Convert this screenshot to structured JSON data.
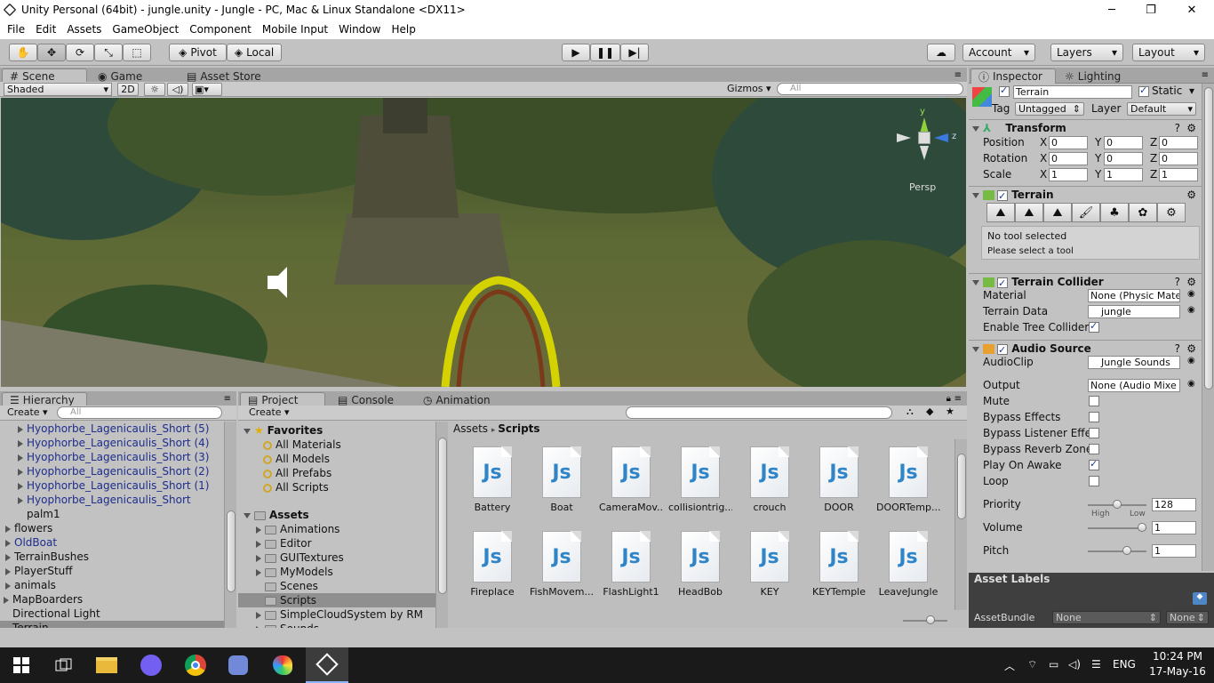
{
  "window": {
    "title": "Unity Personal (64bit) - jungle.unity - Jungle - PC, Mac & Linux Standalone <DX11>",
    "min": "─",
    "max": "❐",
    "close": "✕"
  },
  "menu": [
    "File",
    "Edit",
    "Assets",
    "GameObject",
    "Component",
    "Mobile Input",
    "Window",
    "Help"
  ],
  "toolbar": {
    "pivot": "Pivot",
    "local": "Local",
    "account": "Account",
    "layers": "Layers",
    "layout": "Layout"
  },
  "scene_panel": {
    "tabs": [
      "Scene",
      "Game",
      "Asset Store"
    ],
    "shading": "Shaded",
    "mode2d": "2D",
    "gizmos": "Gizmos",
    "search_placeholder": "All",
    "persp": "Persp",
    "axis_y": "y",
    "axis_z": "z"
  },
  "hierarchy": {
    "tab": "Hierarchy",
    "create": "Create",
    "search_placeholder": "All",
    "items": [
      {
        "label": "Hyophorbe_Lagenicaulis_Short (5)",
        "indent": 1,
        "prefab": true,
        "arrow": true
      },
      {
        "label": "Hyophorbe_Lagenicaulis_Short (4)",
        "indent": 1,
        "prefab": true,
        "arrow": true
      },
      {
        "label": "Hyophorbe_Lagenicaulis_Short (3)",
        "indent": 1,
        "prefab": true,
        "arrow": true
      },
      {
        "label": "Hyophorbe_Lagenicaulis_Short (2)",
        "indent": 1,
        "prefab": true,
        "arrow": true
      },
      {
        "label": "Hyophorbe_Lagenicaulis_Short (1)",
        "indent": 1,
        "prefab": true,
        "arrow": true
      },
      {
        "label": "Hyophorbe_Lagenicaulis_Short",
        "indent": 1,
        "prefab": true,
        "arrow": true
      },
      {
        "label": "palm1",
        "indent": 1,
        "prefab": false,
        "arrow": false
      },
      {
        "label": "flowers",
        "indent": 0,
        "prefab": false,
        "arrow": true
      },
      {
        "label": "OldBoat",
        "indent": 0,
        "prefab": true,
        "arrow": true
      },
      {
        "label": "TerrainBushes",
        "indent": 0,
        "prefab": false,
        "arrow": true
      },
      {
        "label": "PlayerStuff",
        "indent": 0,
        "prefab": false,
        "arrow": true
      },
      {
        "label": "animals",
        "indent": 0,
        "prefab": false,
        "arrow": true
      },
      {
        "label": "MapBoarders",
        "indent": -1,
        "prefab": false,
        "arrow": true
      },
      {
        "label": "Directional Light",
        "indent": -1,
        "prefab": false,
        "arrow": false
      },
      {
        "label": "Terrain",
        "indent": -1,
        "prefab": false,
        "arrow": false,
        "selected": true
      }
    ]
  },
  "project": {
    "tabs": [
      "Project",
      "Console",
      "Animation"
    ],
    "create": "Create",
    "favorites": {
      "label": "Favorites",
      "items": [
        "All Materials",
        "All Models",
        "All Prefabs",
        "All Scripts"
      ]
    },
    "assets": {
      "label": "Assets",
      "folders": [
        "Animations",
        "Editor",
        "GUITextures",
        "MyModels",
        "Scenes",
        "Scripts",
        "SimpleCloudSystem by RM",
        "Sounds"
      ],
      "selected": "Scripts"
    },
    "breadcrumb": [
      "Assets",
      "Scripts"
    ],
    "js_badge": "Js",
    "scripts": [
      "Battery",
      "Boat",
      "CameraMov...",
      "collisiontrig...",
      "crouch",
      "DOOR",
      "DOORTemp...",
      "Fireplace",
      "FishMovem...",
      "FlashLight1",
      "HeadBob",
      "KEY",
      "KEYTemple",
      "LeaveJungle"
    ]
  },
  "inspector": {
    "tabs": [
      "Inspector",
      "Lighting"
    ],
    "object_name": "Terrain",
    "static_label": "Static",
    "tag_label": "Tag",
    "tag_value": "Untagged",
    "layer_label": "Layer",
    "layer_value": "Default",
    "transform": {
      "title": "Transform",
      "rows": [
        {
          "label": "Position",
          "x": "0",
          "y": "0",
          "z": "0"
        },
        {
          "label": "Rotation",
          "x": "0",
          "y": "0",
          "z": "0"
        },
        {
          "label": "Scale",
          "x": "1",
          "y": "1",
          "z": "1"
        }
      ]
    },
    "terrain": {
      "title": "Terrain",
      "no_tool": "No tool selected",
      "please": "Please select a tool"
    },
    "collider": {
      "title": "Terrain Collider",
      "material_label": "Material",
      "material_value": "None (Physic Mate",
      "data_label": "Terrain Data",
      "data_value": "jungle",
      "tree_label": "Enable Tree Collider"
    },
    "audio": {
      "title": "Audio Source",
      "clip_label": "AudioClip",
      "clip_value": "Jungle Sounds",
      "output_label": "Output",
      "output_value": "None (Audio Mixe",
      "toggles": [
        {
          "label": "Mute",
          "on": false
        },
        {
          "label": "Bypass Effects",
          "on": false
        },
        {
          "label": "Bypass Listener Effe",
          "on": false
        },
        {
          "label": "Bypass Reverb Zone",
          "on": false
        },
        {
          "label": "Play On Awake",
          "on": true
        },
        {
          "label": "Loop",
          "on": false
        }
      ],
      "priority_label": "Priority",
      "priority_value": "128",
      "priority_level": 0.5,
      "high": "High",
      "low": "Low",
      "volume_label": "Volume",
      "volume_value": "1",
      "volume_level": 1.0,
      "pitch_label": "Pitch",
      "pitch_value": "1",
      "pitch_level": 0.7
    },
    "asset_labels": "Asset Labels",
    "assetbundle_label": "AssetBundle",
    "assetbundle_value": "None",
    "assetbundle_variant": "None"
  },
  "taskbar": {
    "lang": "ENG",
    "time": "10:24 PM",
    "date": "17-May-16"
  },
  "colors": {
    "prefab_blue": "#1e2d8c",
    "selection": "#8f8f8f",
    "js_blue": "#2f85c7"
  },
  "icons": [
    "hand-icon",
    "move-icon",
    "rotate-icon",
    "scale-icon",
    "rect-icon",
    "play-icon",
    "pause-icon",
    "step-icon",
    "cloud-icon",
    "windows-start-icon"
  ]
}
